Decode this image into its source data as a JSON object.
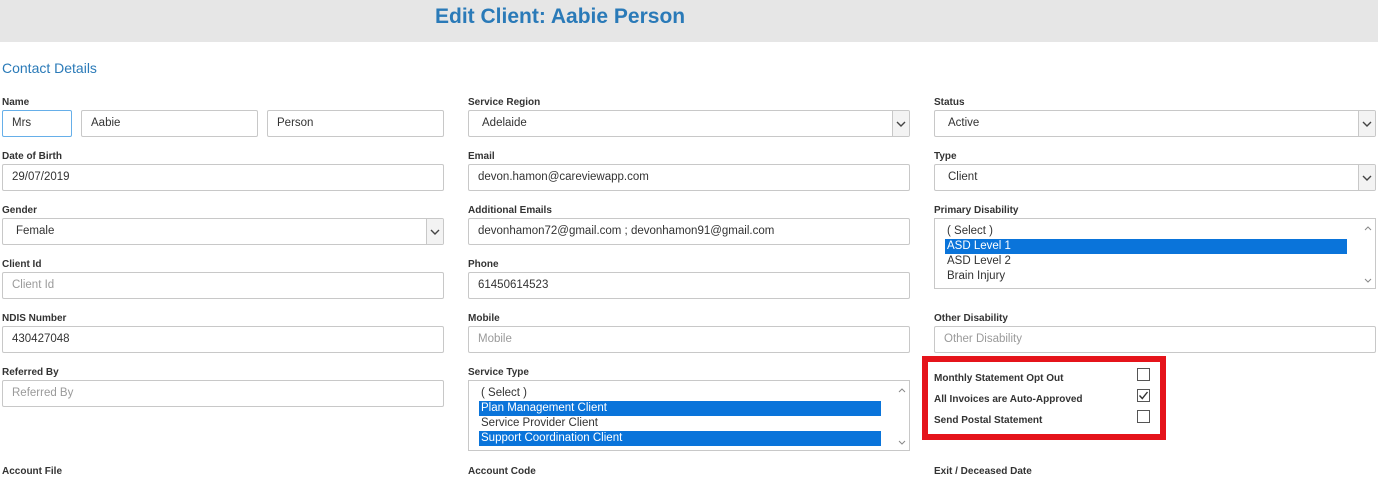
{
  "page": {
    "title": "Edit Client: Aabie Person"
  },
  "section": {
    "title": "Contact Details"
  },
  "name": {
    "label": "Name",
    "title": "Mrs",
    "first": "Aabie",
    "last": "Person"
  },
  "dob": {
    "label": "Date of Birth",
    "value": "29/07/2019"
  },
  "gender": {
    "label": "Gender",
    "value": "Female"
  },
  "client_id": {
    "label": "Client Id",
    "placeholder": "Client Id"
  },
  "ndis": {
    "label": "NDIS Number",
    "value": "430427048"
  },
  "referred_by": {
    "label": "Referred By",
    "placeholder": "Referred By"
  },
  "account_file": {
    "label": "Account File"
  },
  "service_region": {
    "label": "Service Region",
    "value": "Adelaide"
  },
  "email": {
    "label": "Email",
    "value": "devon.hamon@careviewapp.com"
  },
  "additional_emails": {
    "label": "Additional Emails",
    "value": "devonhamon72@gmail.com ; devonhamon91@gmail.com"
  },
  "phone": {
    "label": "Phone",
    "value": "61450614523"
  },
  "mobile": {
    "label": "Mobile",
    "placeholder": "Mobile"
  },
  "service_type": {
    "label": "Service Type",
    "options": [
      {
        "label": "( Select )",
        "selected": false
      },
      {
        "label": "Plan Management Client",
        "selected": true
      },
      {
        "label": "Service Provider Client",
        "selected": false
      },
      {
        "label": "Support Coordination Client",
        "selected": true
      }
    ]
  },
  "account_code": {
    "label": "Account Code"
  },
  "status": {
    "label": "Status",
    "value": "Active"
  },
  "type": {
    "label": "Type",
    "value": "Client"
  },
  "primary_disability": {
    "label": "Primary Disability",
    "options": [
      {
        "label": "( Select )",
        "selected": false
      },
      {
        "label": "ASD Level 1",
        "selected": true
      },
      {
        "label": "ASD Level 2",
        "selected": false
      },
      {
        "label": "Brain Injury",
        "selected": false
      }
    ]
  },
  "other_disability": {
    "label": "Other Disability",
    "placeholder": "Other Disability"
  },
  "checkboxes": {
    "monthly": {
      "label": "Monthly Statement Opt Out",
      "checked": false
    },
    "auto_approved": {
      "label": "All Invoices are Auto-Approved",
      "checked": true
    },
    "postal": {
      "label": "Send Postal Statement",
      "checked": false
    }
  },
  "exit_date": {
    "label": "Exit / Deceased Date"
  },
  "colors": {
    "accent": "#2a7ab8",
    "selection": "#0a74da",
    "highlight": "#e5141b",
    "header_bg": "#e6e6e6"
  }
}
